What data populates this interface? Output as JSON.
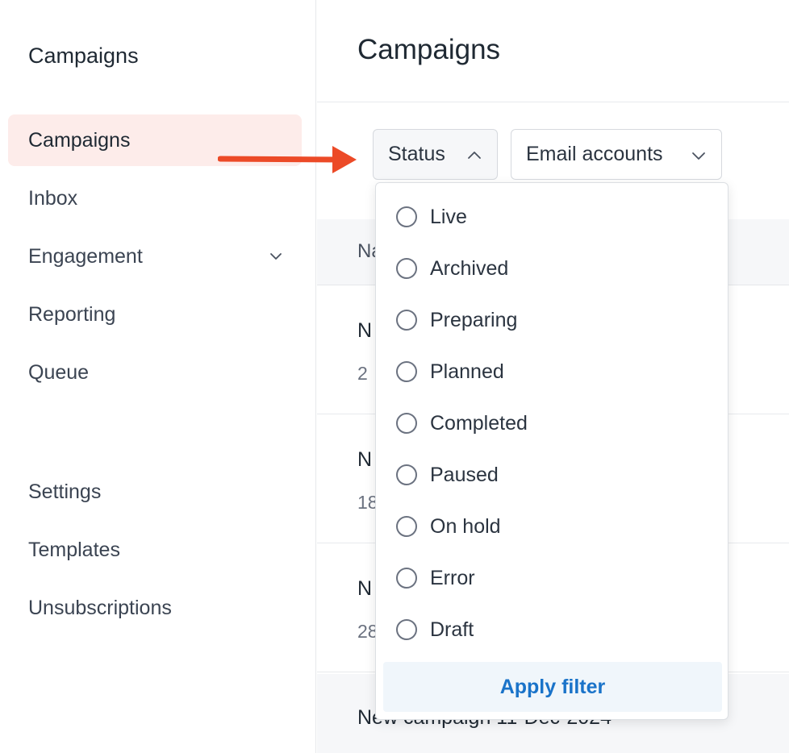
{
  "sidebar": {
    "title": "Campaigns",
    "items": [
      {
        "label": "Campaigns",
        "active": true
      },
      {
        "label": "Inbox"
      },
      {
        "label": "Engagement",
        "has_chevron": true
      },
      {
        "label": "Reporting"
      },
      {
        "label": "Queue"
      }
    ],
    "bottom_items": [
      {
        "label": "Settings"
      },
      {
        "label": "Templates"
      },
      {
        "label": "Unsubscriptions"
      }
    ]
  },
  "main": {
    "title": "Campaigns",
    "filters": {
      "status_label": "Status",
      "email_accounts_label": "Email accounts"
    },
    "table": {
      "header_col1": "Na",
      "rows": [
        {
          "name": "N",
          "meta": "2"
        },
        {
          "name": "N",
          "meta": "18"
        },
        {
          "name": "N",
          "meta": "28"
        },
        {
          "name": "New campaign 11-Dec-2024"
        }
      ]
    }
  },
  "status_dropdown": {
    "options": [
      "Live",
      "Archived",
      "Preparing",
      "Planned",
      "Completed",
      "Paused",
      "On hold",
      "Error",
      "Draft"
    ],
    "apply_label": "Apply filter"
  },
  "colors": {
    "active_bg": "#fdecea",
    "arrow": "#ec4a27",
    "apply_text": "#1a73c9"
  }
}
